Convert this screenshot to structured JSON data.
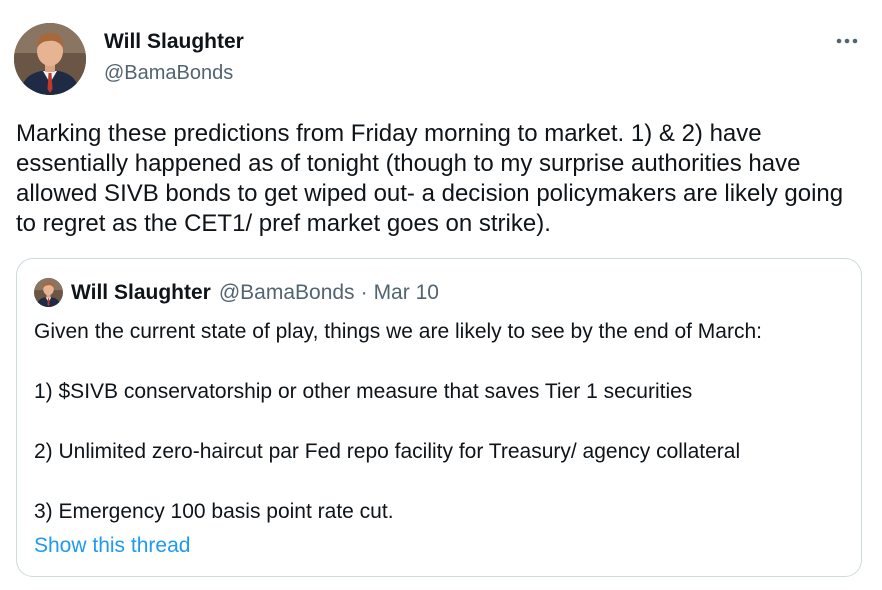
{
  "tweet": {
    "author": {
      "display_name": "Will Slaughter",
      "handle": "@BamaBonds",
      "avatar_icon": "profile-photo"
    },
    "more_icon": "more-horizontal-icon",
    "text": "Marking these predictions from Friday morning to market. 1) & 2) have essentially happened as of tonight (though to my surprise authorities have allowed SIVB bonds to get wiped out- a decision policymakers are likely going to regret as the CET1/ pref market goes on strike)."
  },
  "quoted_tweet": {
    "author": {
      "display_name": "Will Slaughter",
      "handle": "@BamaBonds",
      "avatar_icon": "profile-photo"
    },
    "separator": "·",
    "date": "Mar 10",
    "text": "Given the current state of play, things we are likely to see by the end of March:\n\n1) $SIVB conservatorship or other measure that saves Tier 1 securities\n\n2) Unlimited zero-haircut par Fed repo facility for Treasury/ agency collateral\n\n3) Emergency 100 basis point rate cut.",
    "show_thread_label": "Show this thread"
  },
  "colors": {
    "text_primary": "#0f1419",
    "text_secondary": "#536471",
    "link": "#1d9bf0",
    "border": "#cfd9de"
  }
}
